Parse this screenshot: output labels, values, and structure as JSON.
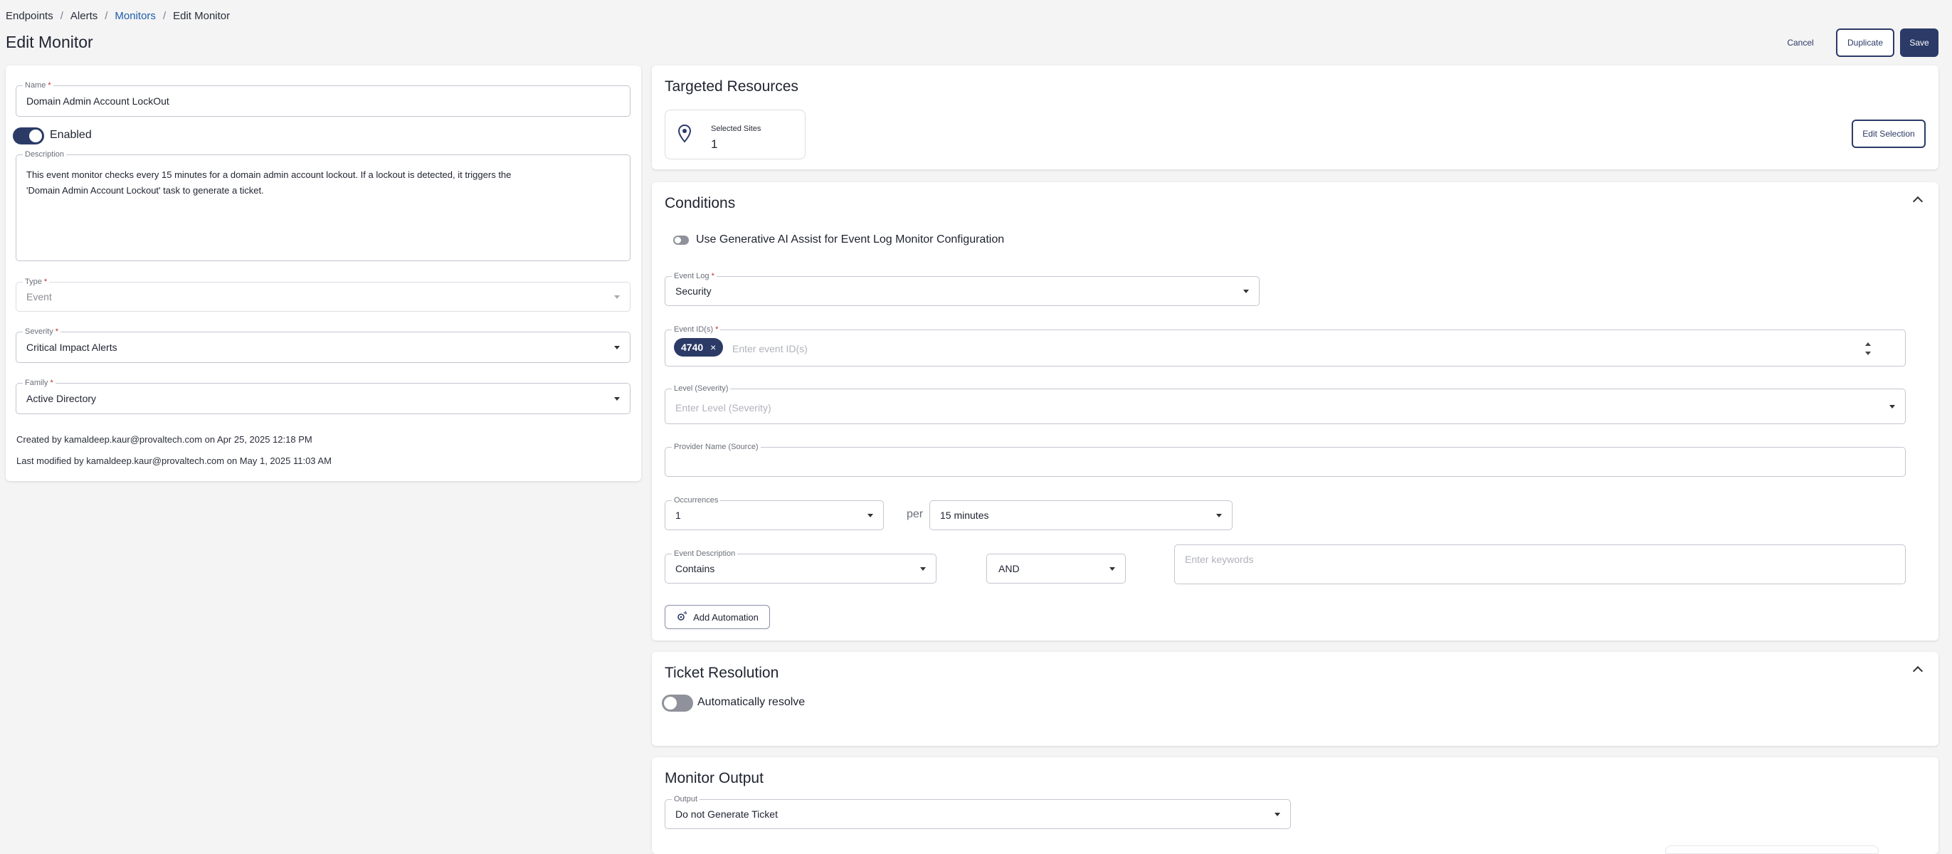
{
  "breadcrumb": [
    {
      "label": "Endpoints"
    },
    {
      "label": "Alerts"
    },
    {
      "label": "Monitors"
    },
    {
      "label": "Edit Monitor"
    }
  ],
  "page": {
    "title": "Edit Monitor"
  },
  "actions": {
    "cancel": "Cancel",
    "duplicate": "Duplicate",
    "save": "Save"
  },
  "general": {
    "name_label": "Name",
    "name_value": "Domain Admin Account LockOut",
    "enabled_label": "Enabled",
    "enabled": true,
    "description_label": "Description",
    "description_line1": "This event monitor checks every 15 minutes for a domain admin account lockout. If a lockout is detected, it triggers the",
    "description_line2": "'Domain Admin Account Lockout' task to generate a ticket.",
    "type_label": "Type",
    "type_value": "Event",
    "severity_label": "Severity",
    "severity_value": "Critical Impact Alerts",
    "family_label": "Family",
    "family_value": "Active Directory",
    "created_by": "Created by kamaldeep.kaur@provaltech.com on Apr 25, 2025 12:18 PM",
    "modified_by": "Last modified by kamaldeep.kaur@provaltech.com on May 1, 2025 11:03 AM"
  },
  "targeted": {
    "title": "Targeted Resources",
    "selected_sites_label": "Selected Sites",
    "selected_sites_count": "1",
    "edit_selection": "Edit Selection"
  },
  "conditions": {
    "title": "Conditions",
    "gen_ai_label": "Use Generative AI Assist for Event Log Monitor Configuration",
    "event_log_label": "Event Log",
    "event_log_value": "Security",
    "event_ids_label": "Event ID(s)",
    "event_ids": [
      "4740"
    ],
    "event_ids_placeholder": "Enter event ID(s)",
    "level_label": "Level (Severity)",
    "level_placeholder": "Enter Level (Severity)",
    "provider_label": "Provider Name (Source)",
    "provider_value": "",
    "occurrences_label": "Occurrences",
    "occurrences_value": "1",
    "per_label": "per",
    "interval_value": "15 minutes",
    "event_desc_label": "Event Description",
    "event_desc_value": "Contains",
    "operator_value": "AND",
    "keywords_placeholder": "Enter keywords",
    "add_automation": "Add Automation"
  },
  "resolution": {
    "title": "Ticket Resolution",
    "auto_resolve_label": "Automatically resolve",
    "auto_resolve": false
  },
  "output": {
    "title": "Monitor Output",
    "output_label": "Output",
    "output_value": "Do not Generate Ticket"
  }
}
